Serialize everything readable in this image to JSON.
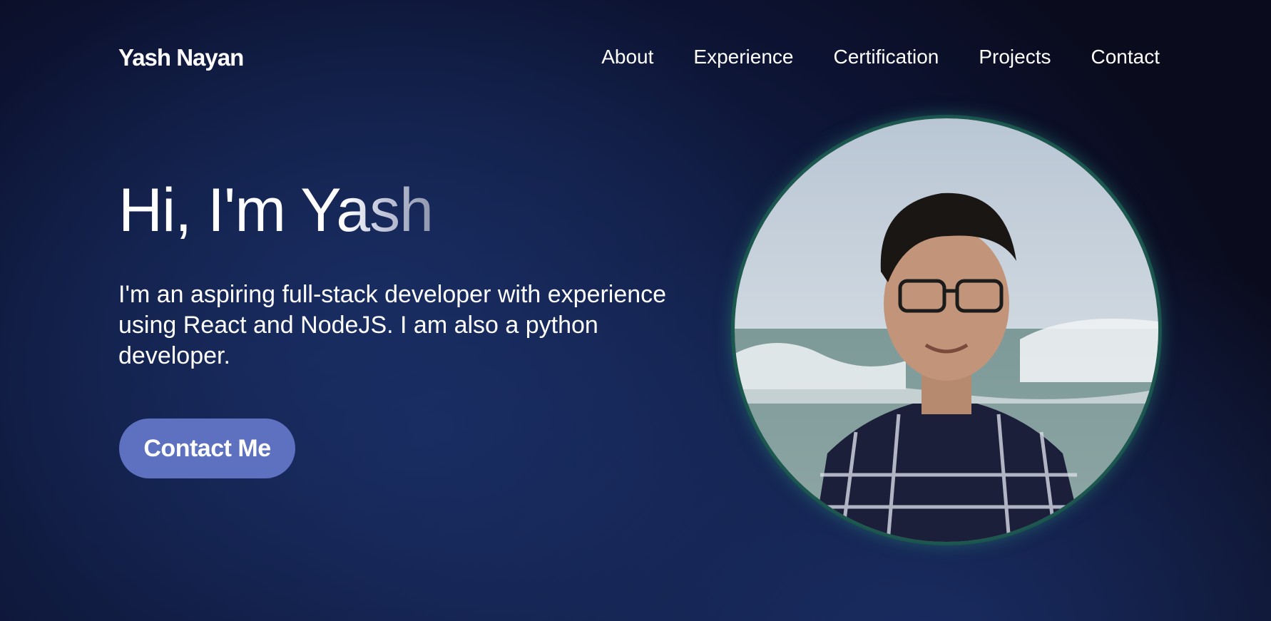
{
  "header": {
    "brand": "Yash Nayan",
    "nav": [
      {
        "label": "About"
      },
      {
        "label": "Experience"
      },
      {
        "label": "Certification"
      },
      {
        "label": "Projects"
      },
      {
        "label": "Contact"
      }
    ]
  },
  "hero": {
    "title": "Hi, I'm Yash",
    "description": "I'm an aspiring full-stack developer with experience using React and NodeJS. I am also a python developer.",
    "cta_label": "Contact Me"
  },
  "profile": {
    "image_subject": "portrait-photo"
  },
  "colors": {
    "button": "#5e70c0",
    "background_dark": "#0a0b1c",
    "background_blue": "#18295c",
    "avatar_ring": "#16473f"
  }
}
